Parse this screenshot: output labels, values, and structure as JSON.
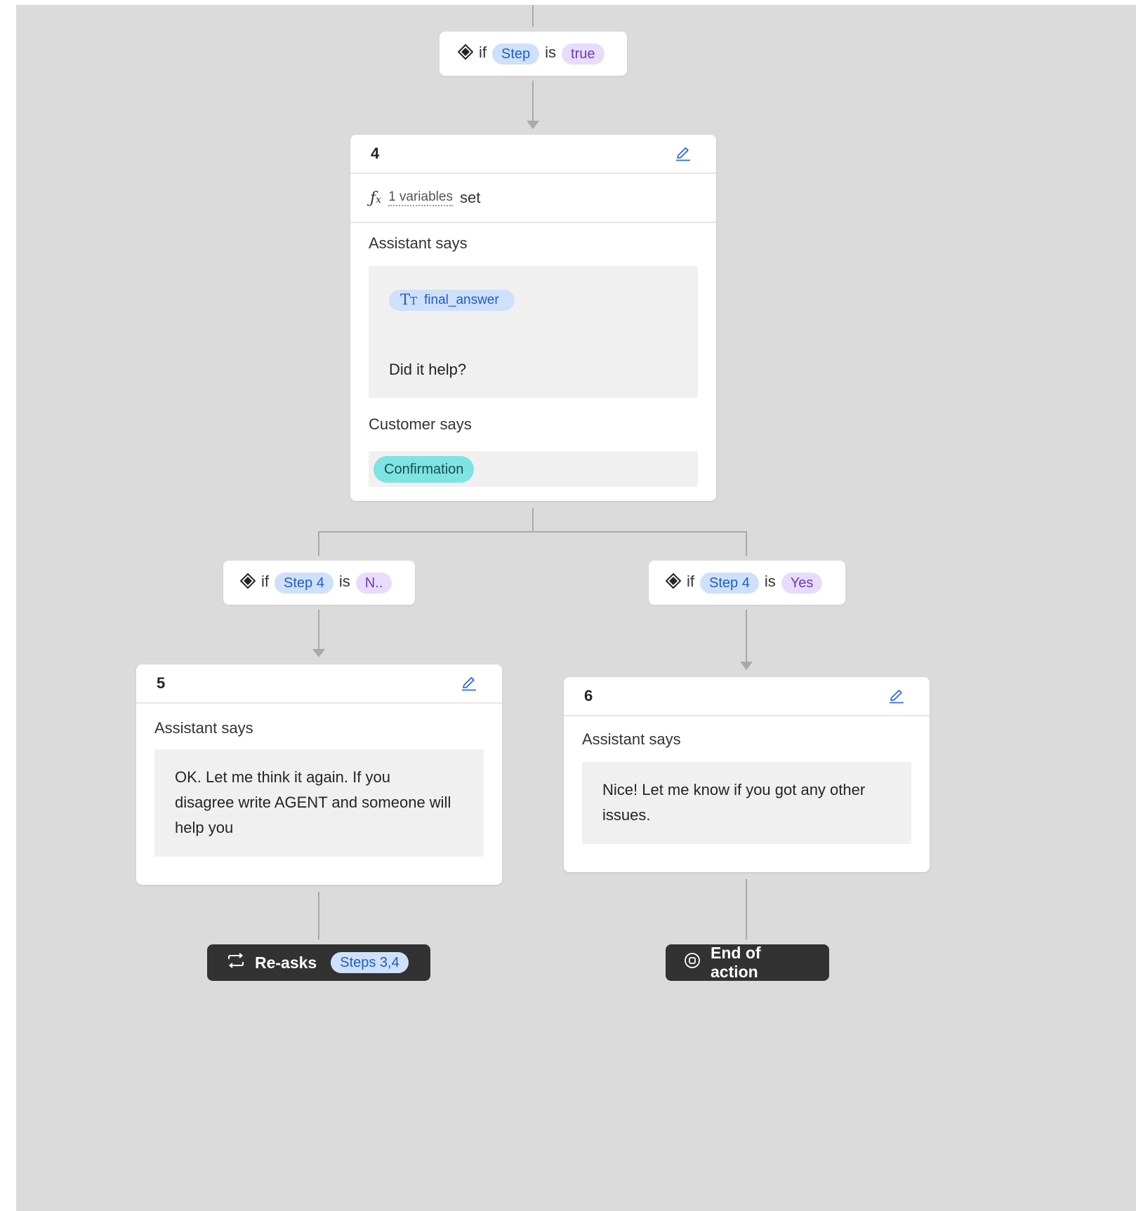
{
  "flow": {
    "top_condition": {
      "if_word": "if",
      "subject": "Step",
      "is_word": "is",
      "value": "true"
    },
    "step4": {
      "number": "4",
      "variables_count_label": "1 variables",
      "variables_suffix": "set",
      "assistant_label": "Assistant says",
      "variable_chip": "final_answer",
      "message": "Did it help?",
      "customer_label": "Customer says",
      "customer_entity": "Confirmation"
    },
    "left_condition": {
      "if_word": "if",
      "subject": "Step 4",
      "is_word": "is",
      "value": "N.."
    },
    "right_condition": {
      "if_word": "if",
      "subject": "Step 4",
      "is_word": "is",
      "value": "Yes"
    },
    "step5": {
      "number": "5",
      "assistant_label": "Assistant says",
      "message_lines": [
        "OK. Let me think it again. If you",
        "disagree write AGENT and someone will",
        "help you"
      ]
    },
    "step6": {
      "number": "6",
      "assistant_label": "Assistant says",
      "message_lines": [
        "Nice! Let me know if you got any other",
        "issues."
      ]
    },
    "reask": {
      "label": "Re-asks",
      "steps_badge": "Steps 3,4"
    },
    "end": {
      "label": "End of action"
    }
  },
  "colors": {
    "canvas": "#dbdbdb",
    "connector": "#a9a9a9",
    "chip_blue_bg": "#cfe0fb",
    "chip_purple_bg": "#e9dcfa",
    "entity_bg": "#7ee3e3",
    "terminal_bg": "#323232",
    "edit_icon": "#2a6fd6"
  }
}
